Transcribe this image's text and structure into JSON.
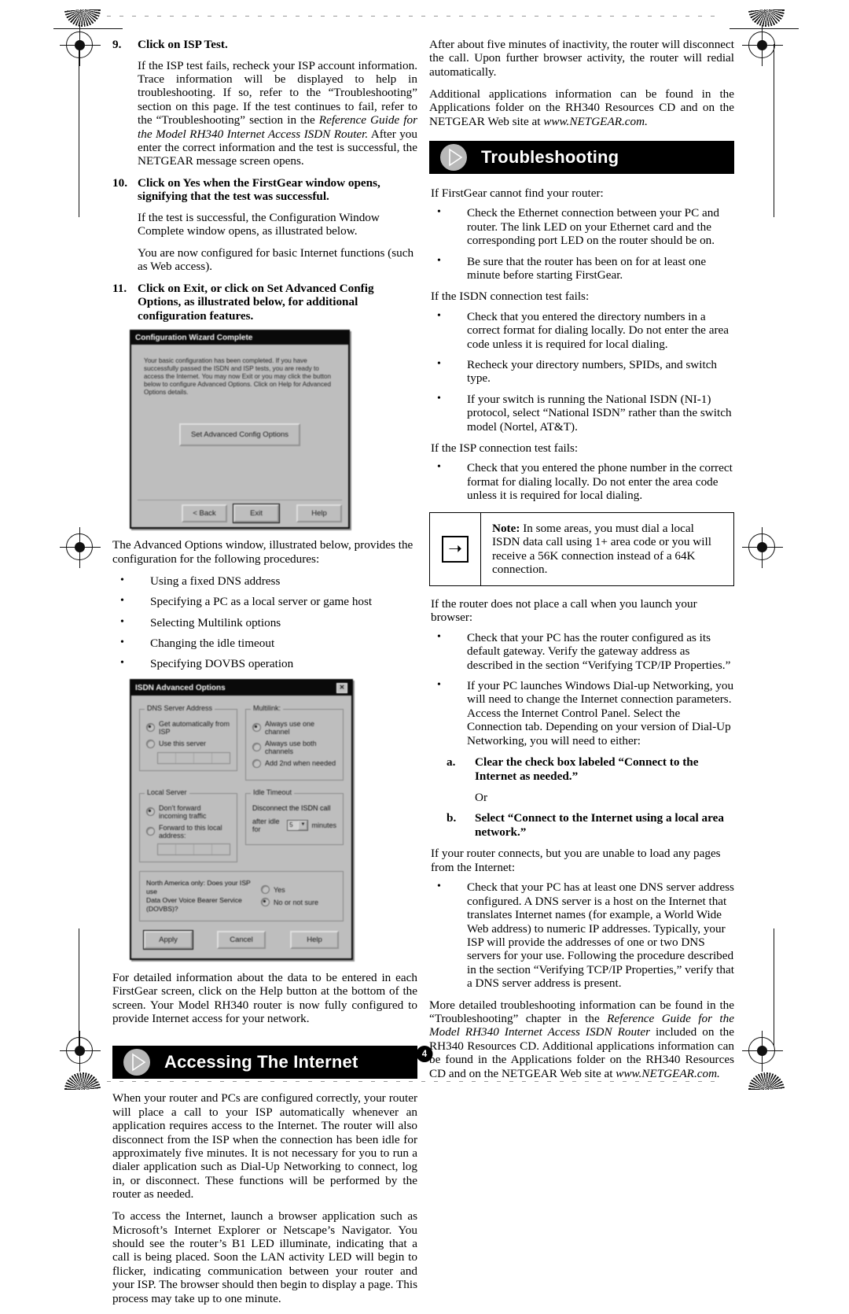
{
  "page": {
    "number": "4"
  },
  "left_column": {
    "step9": {
      "num": "9.",
      "title": "Click on ISP Test.",
      "body_1": "If the ISP test fails, recheck your ISP account information. Trace information will be displayed to help in troubleshooting. If so, refer to the “Troubleshooting” section on this page. If the test continues to fail, refer to the “Troubleshooting” section in the ",
      "body_italic": "Reference Guide for the Model RH340 Internet Access ISDN Router.",
      "body_2": " After you enter the correct information and the test is successful, the NETGEAR message screen opens."
    },
    "step10": {
      "num": "10.",
      "title": "Click on Yes when the FirstGear window opens, signifying that the test was successful.",
      "body_1": "If the test is successful, the Configuration Window Complete window opens, as illustrated below.",
      "body_2": "You are now configured for basic Internet functions (such as Web access)."
    },
    "step11": {
      "num": "11.",
      "title": "Click on Exit, or click on Set Advanced Config Options, as illustrated below, for additional configuration features."
    },
    "advanced_intro": "The Advanced Options window, illustrated below, provides the configuration for the following procedures:",
    "advanced_bullets": [
      "Using a fixed DNS address",
      "Specifying a PC as a local server or game host",
      "Selecting Multilink options",
      "Changing the idle timeout",
      "Specifying DOVBS operation"
    ],
    "help_paragraph": "For detailed information about the data to be entered in each FirstGear screen, click on the Help button at the bottom of the screen. Your Model RH340 router is now fully configured to provide Internet access for your network.",
    "banner": {
      "title": "Accessing The Internet",
      "icon": "play-circle-icon"
    },
    "access_p1": "When your router and PCs are configured correctly, your router will place a call to your ISP automatically whenever an application requires access to the Internet. The router will also disconnect from the ISP when the connection has been idle for approximately five minutes. It is not necessary for you to run a dialer application such as Dial-Up Networking to connect, log in, or disconnect. These functions will be performed by the router as needed.",
    "access_p2": "To access the Internet, launch a browser application such as Microsoft’s Internet Explorer or Netscape’s Navigator. You should see the router’s B1 LED illuminate, indicating that a call is being placed. Soon the LAN activity LED will begin to flicker, indicating communication between your router and your ISP. The browser should then begin to display a page. This process may take up to one minute."
  },
  "figure_wizard": {
    "title": "Configuration Wizard Complete",
    "message": "Your basic configuration has been completed. If you have successfully passed the ISDN and ISP tests, you are ready to access the Internet. You may now Exit or you may click the button below to configure Advanced Options. Click on Help for Advanced Options details.",
    "main_button": "Set Advanced Config Options",
    "back_button": "< Back",
    "exit_button": "Exit",
    "help_button": "Help"
  },
  "figure_isdn": {
    "title": "ISDN Advanced Options",
    "close_label": "✕",
    "dns_group": {
      "legend": "DNS Server Address",
      "option_auto": "Get automatically from ISP",
      "option_manual": "Use this server"
    },
    "multilink_group": {
      "legend": "Multilink:",
      "option_one": "Always use one channel",
      "option_both": "Always use both channels",
      "option_add": "Add 2nd when needed"
    },
    "local_server_group": {
      "legend": "Local Server",
      "option_dont": "Don’t forward incoming traffic",
      "option_forward": "Forward to this local address:"
    },
    "idle_group": {
      "legend": "Idle Timeout",
      "line1": "Disconnect the ISDN call",
      "line2_prefix": "after idle for",
      "value": "5",
      "line2_suffix": "minutes"
    },
    "dovbs": {
      "question_line1": "North America only: Does your ISP use",
      "question_line2": "Data Over Voice Bearer Service (DOVBS)?",
      "option_yes": "Yes",
      "option_no": "No or not sure"
    },
    "apply_button": "Apply",
    "cancel_button": "Cancel",
    "help_button": "Help"
  },
  "right_column": {
    "intro_p1": "After about five minutes of inactivity, the router will disconnect the call. Upon further browser activity, the router will redial automatically.",
    "intro_p2_a": "Additional applications information can be found in the Applications folder on the RH340 Resources CD and on the NETGEAR Web site at ",
    "intro_p2_italic": "www.NETGEAR.com.",
    "banner": {
      "title": "Troubleshooting",
      "icon": "play-circle-icon"
    },
    "lead_firstgear": "If FirstGear cannot find your router:",
    "firstgear_bullets": [
      "Check the Ethernet connection between your PC and router. The link LED on your Ethernet card and the corresponding port LED on the router should be on.",
      "Be sure that the router has been on for at least one minute before starting FirstGear."
    ],
    "lead_isdn": "If the ISDN connection test fails:",
    "isdn_bullets": [
      "Check that you entered the directory numbers in a correct format for dialing locally. Do not enter the area code unless it is required for local dialing.",
      "Recheck your directory numbers, SPIDs, and switch type.",
      "If your switch is running the National ISDN (NI-1) protocol, select “National ISDN” rather than the switch model (Nortel, AT&T)."
    ],
    "lead_isp": "If the ISP connection test fails:",
    "isp_bullets": [
      "Check that you entered the phone number in the correct format for dialing locally. Do not enter the area code unless it is required for local dialing."
    ],
    "note": {
      "icon": "arrow-right-icon",
      "label": "Note:",
      "text": " In some areas, you must dial a local ISDN data call using 1+ area code or you will receive a 56K connection instead of a 64K connection."
    },
    "lead_browser": "If the router does not place a call when you launch your browser:",
    "browser_bullets": [
      "Check that your PC has the router configured as its default gateway. Verify the gateway address as described in the section “Verifying TCP/IP Properties.”",
      "If your PC launches Windows Dial-up Networking, you will need to change the Internet connection parameters. Access the Internet Control Panel. Select the Connection tab. Depending on your version of Dial-Up Networking, you will need to either:"
    ],
    "sub_options": [
      {
        "label": "a.",
        "text": "Clear the check box labeled “Connect to the Internet as needed.”"
      },
      {
        "label": "b.",
        "text": " Select “Connect to the Internet using a local area network.”"
      }
    ],
    "or_label": "Or",
    "lead_pages": "If your router connects, but you are unable to load any pages from the Internet:",
    "pages_bullets": [
      "Check that your PC has at least one DNS server address configured. A DNS server is a host on the Internet that translates Internet names (for example, a World Wide Web address) to numeric IP addresses. Typically, your ISP will provide the addresses of one or two DNS servers for your use. Following the procedure described in the section “Verifying TCP/IP Properties,” verify that a DNS server address is present."
    ],
    "closing_a": "More detailed troubleshooting information can be found in the “Troubleshooting” chapter in the ",
    "closing_italic_1": "Reference Guide for the Model RH340 Internet Access ISDN Router",
    "closing_b": " included on the RH340 Resources CD. Additional applications information can be found in the Applications folder on the RH340 Resources CD and on the NETGEAR Web site at ",
    "closing_italic_2": "www.NETGEAR.com."
  }
}
